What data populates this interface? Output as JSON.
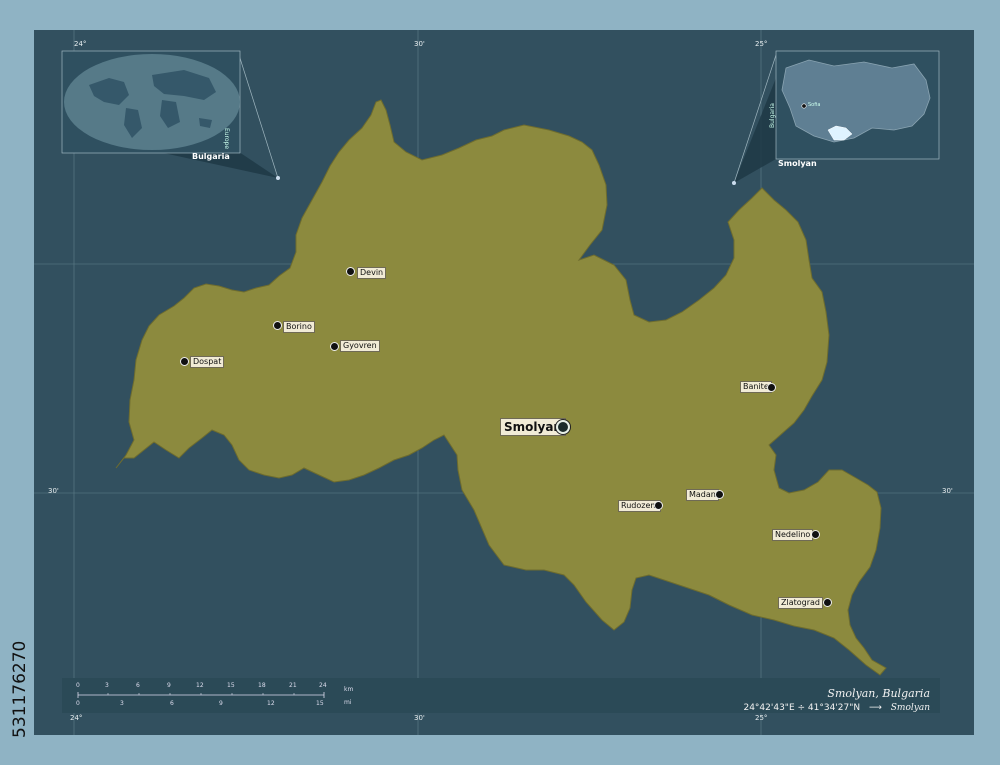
{
  "map": {
    "title": "Smolyan, Bulgaria",
    "coordinates": "24°42'43\"E ÷ 41°34'27\"N",
    "pointer_label": "Smolyan",
    "arrow": "⟶",
    "stock_id": "531176270",
    "colors": {
      "background": "#8fb3c4",
      "frame": "#32505f",
      "region_fill": "#8c8a3e",
      "region_stroke": "#6e6c2e"
    }
  },
  "graticule": {
    "top": [
      "24°",
      "30'",
      "25°"
    ],
    "left_mid": "30'",
    "right_mid": "30'",
    "bottom": [
      "24°",
      "30'",
      "25°"
    ]
  },
  "cities": [
    {
      "name": "Devin"
    },
    {
      "name": "Borino"
    },
    {
      "name": "Gyovren"
    },
    {
      "name": "Dospat"
    },
    {
      "name": "Banite"
    },
    {
      "name": "Madan"
    },
    {
      "name": "Rudozem"
    },
    {
      "name": "Nedelino"
    },
    {
      "name": "Zlatograd"
    }
  ],
  "capital": {
    "name": "Smolyan"
  },
  "inset_world": {
    "label": "Bulgaria",
    "side_label": "Europe"
  },
  "inset_country": {
    "label": "Smolyan",
    "side_label": "Bulgaria",
    "city": "Sofia"
  },
  "scale": {
    "km_ticks": [
      "0",
      "3",
      "6",
      "9",
      "12",
      "15",
      "18",
      "21",
      "24"
    ],
    "km_unit": "km",
    "mi_ticks": [
      "0",
      "3",
      "6",
      "9",
      "12",
      "15"
    ],
    "mi_unit": "mi"
  }
}
